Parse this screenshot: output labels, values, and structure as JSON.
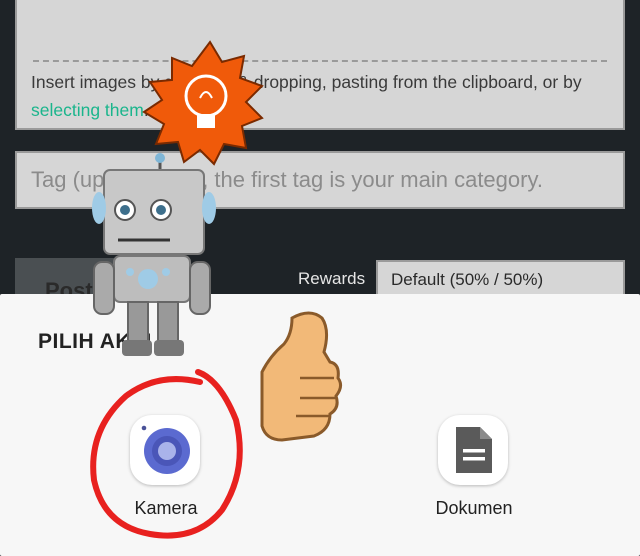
{
  "editor": {
    "drop_text_before": "Insert images by dragging & dropping, pasting from the clipboard, or by ",
    "drop_link": "selecting them",
    "drop_text_after": ".",
    "tag_placeholder": "Tag (up to 5 tags), the first tag is your main category.",
    "post_button": "Post",
    "rewards_label": "Rewards",
    "rewards_value": "Default (50% / 50%)"
  },
  "sheet": {
    "title": "PILIH AKSI",
    "apps": [
      {
        "label": "Kamera",
        "icon": "camera-icon"
      },
      {
        "label": "Dokumen",
        "icon": "document-icon"
      }
    ]
  },
  "stickers": [
    "robot-sticker",
    "lightbulb-sticker",
    "thumbs-up-sticker",
    "red-circle-annotation"
  ],
  "colors": {
    "link": "#1ab58c",
    "camera": "#5b6ad0",
    "annotation": "#e8211f",
    "burst": "#f05a0a"
  }
}
